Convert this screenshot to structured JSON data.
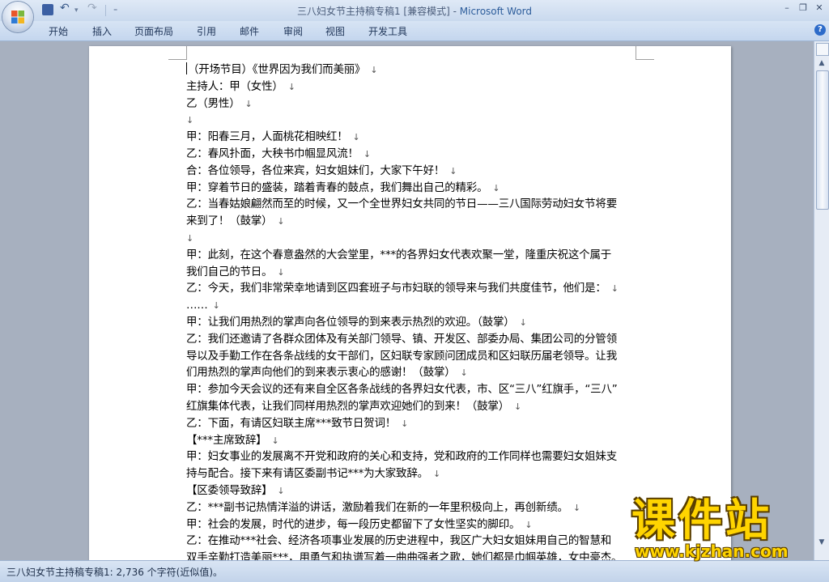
{
  "window": {
    "title_doc": "三八妇女节主持稿专稿1 [兼容模式]",
    "title_sep": " - ",
    "title_app": "Microsoft Word",
    "controls": {
      "minimize": "–",
      "restore": "❐",
      "close": "✕"
    }
  },
  "quick_access": {
    "undo": "↶",
    "undo_dropdown": "▾",
    "redo": "↷",
    "customize": "₌"
  },
  "ribbon": {
    "tabs": [
      "开始",
      "插入",
      "页面布局",
      "引用",
      "邮件",
      "审阅",
      "视图",
      "开发工具"
    ],
    "help": "?"
  },
  "document": {
    "mark": "↓",
    "lines": [
      "（开场节目）《世界因为我们而美丽》",
      "主持人：甲（女性）",
      "乙（男性）",
      "",
      "甲：阳春三月，人面桃花相映红！",
      "乙：春风扑面，大秧书巾帼显风流！",
      "合：各位领导，各位来宾，妇女姐妹们，大家下午好！",
      "甲：穿着节日的盛装，踏着青春的鼓点，我们舞出自己的精彩。",
      "乙：当春姑娘翩然而至的时候，又一个全世界妇女共同的节日——三八国际劳动妇女节将要",
      "来到了！（鼓掌）",
      "",
      "甲：此刻，在这个春意盎然的大会堂里，***的各界妇女代表欢聚一堂，隆重庆祝这个属于",
      "我们自己的节日。",
      "乙：今天，我们非常荣幸地请到区四套班子与市妇联的领导来与我们共度佳节，他们是：",
      "……",
      "甲：让我们用热烈的掌声向各位领导的到来表示热烈的欢迎。（鼓掌）",
      "乙：我们还邀请了各群众团体及有关部门领导、镇、开发区、部委办局、集团公司的分管领",
      "导以及手勤工作在各条战线的女干部们，区妇联专家顾问团成员和区妇联历届老领导。让我",
      "们用热烈的掌声向他们的到来表示衷心的感谢！（鼓掌）",
      "甲：参加今天会议的还有来自全区各条战线的各界妇女代表，市、区“三八”红旗手，“三八”",
      "红旗集体代表，让我们同样用热烈的掌声欢迎她们的到来！（鼓掌）",
      "乙：下面，有请区妇联主席***致节日贺词！",
      "【***主席致辞】",
      "甲：妇女事业的发展离不开党和政府的关心和支持，党和政府的工作同样也需要妇女姐妹支",
      "持与配合。接下来有请区委副书记***为大家致辞。",
      "【区委领导致辞】",
      "乙：***副书记热情洋溢的讲话，激励着我们在新的一年里积极向上，再创新绩。",
      "甲：社会的发展，时代的进步，每一段历史都留下了女性坚实的脚印。",
      "乙：在推动***社会、经济各项事业发展的历史进程中，我区广大妇女姐妹用自己的智慧和",
      "双手辛勤打造美丽***，用勇气和执谱写着一曲曲强者之歌，她们都是巾帼英雄，女中豪杰。"
    ],
    "line_has_mark": [
      true,
      true,
      true,
      true,
      true,
      true,
      true,
      true,
      false,
      true,
      true,
      false,
      true,
      true,
      true,
      true,
      false,
      false,
      true,
      false,
      true,
      true,
      true,
      false,
      true,
      true,
      true,
      true,
      false,
      false
    ]
  },
  "scrollbar": {
    "up": "▲",
    "down": "▼"
  },
  "statusbar": {
    "text": "三八妇女节主持稿专稿1: 2,736 个字符(近似值)。"
  },
  "watermark": {
    "title": "课件站",
    "url": "www.kjzhan.com"
  },
  "colors": {
    "title_app": "#2d5d9b",
    "watermark": "#ffd400"
  }
}
